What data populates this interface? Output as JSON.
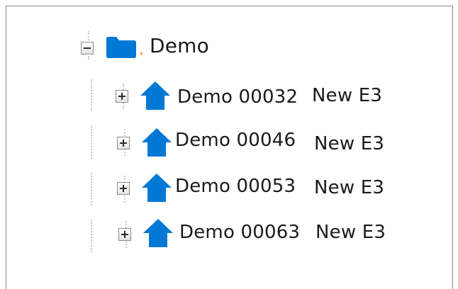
{
  "tree": {
    "root": {
      "label": "Demo",
      "icon": "folder-icon",
      "state": "expanded"
    },
    "children": [
      {
        "name": "Demo 00032",
        "type": "New E3",
        "icon": "house-icon",
        "state": "collapsed"
      },
      {
        "name": "Demo 00046",
        "type": "New E3",
        "icon": "house-icon",
        "state": "collapsed"
      },
      {
        "name": "Demo 00053",
        "type": "New E3",
        "icon": "house-icon",
        "state": "collapsed"
      },
      {
        "name": "Demo 00063",
        "type": "New E3",
        "icon": "house-icon",
        "state": "collapsed"
      }
    ]
  },
  "colors": {
    "icon_blue": "#0078d4",
    "text": "#1a1a1a",
    "border": "#8a8a8a",
    "guide_lines": "#c8c8c8"
  }
}
